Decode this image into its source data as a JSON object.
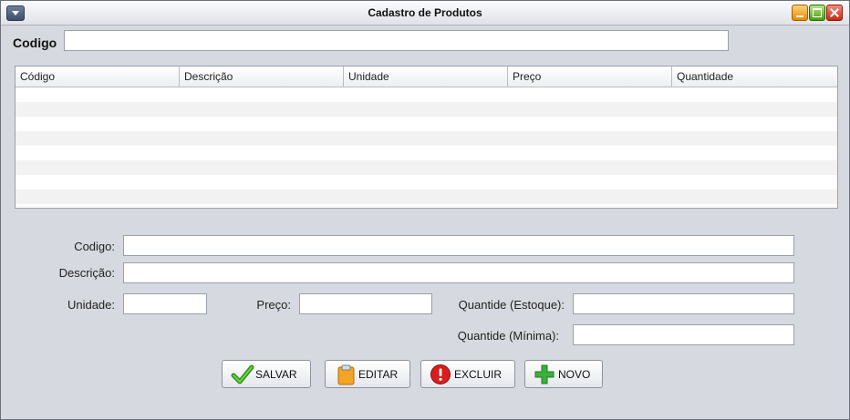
{
  "window": {
    "title": "Cadastro de Produtos"
  },
  "search": {
    "label": "Codigo",
    "value": ""
  },
  "table": {
    "columns": [
      "Código",
      "Descrição",
      "Unidade",
      "Preço",
      "Quantidade"
    ],
    "rows": []
  },
  "form": {
    "codigo_label": "Codigo:",
    "descricao_label": "Descrição:",
    "unidade_label": "Unidade:",
    "preco_label": "Preço:",
    "qtd_estoque_label": "Quantide (Estoque):",
    "qtd_minima_label": "Quantide (Mínima):"
  },
  "buttons": {
    "salvar": "SALVAR",
    "editar": "EDITAR",
    "excluir": "EXCLUIR",
    "novo": "NOVO"
  },
  "icons": {
    "salvar": "check-icon",
    "editar": "clipboard-icon",
    "excluir": "error-icon",
    "novo": "plus-icon"
  },
  "colors": {
    "check": "#3aa61c",
    "clipboard": "#f0a020",
    "error": "#d81e1e",
    "plus": "#3cb03c"
  }
}
